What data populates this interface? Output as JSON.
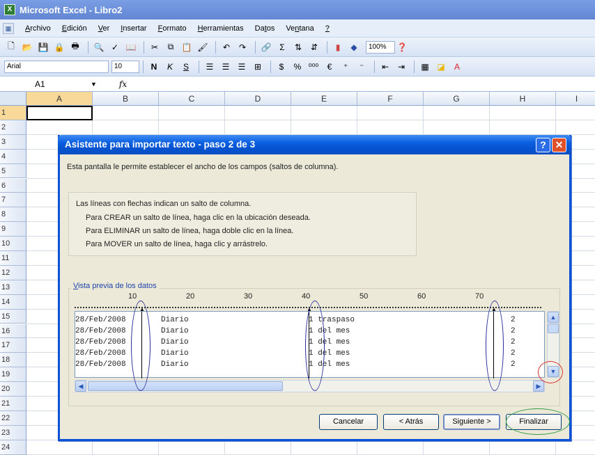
{
  "window": {
    "title": "Microsoft Excel - Libro2"
  },
  "menu": {
    "items": [
      {
        "pre": "",
        "u": "A",
        "post": "rchivo"
      },
      {
        "pre": "",
        "u": "E",
        "post": "dición"
      },
      {
        "pre": "",
        "u": "V",
        "post": "er"
      },
      {
        "pre": "",
        "u": "I",
        "post": "nsertar"
      },
      {
        "pre": "",
        "u": "F",
        "post": "ormato"
      },
      {
        "pre": "",
        "u": "H",
        "post": "erramientas"
      },
      {
        "pre": "Da",
        "u": "t",
        "post": "os"
      },
      {
        "pre": "Ve",
        "u": "n",
        "post": "tana"
      },
      {
        "pre": "",
        "u": "?",
        "post": ""
      }
    ]
  },
  "toolbar": {
    "zoom": "100%",
    "font": "Arial",
    "size": "10",
    "bold": "N",
    "italic": "K",
    "underline": "S"
  },
  "formula": {
    "namebox": "A1",
    "fx": "fx"
  },
  "sheet": {
    "columns": [
      "A",
      "B",
      "C",
      "D",
      "E",
      "F",
      "G",
      "H",
      "I"
    ],
    "rows": [
      "1",
      "2",
      "3",
      "4",
      "5",
      "6",
      "7",
      "8",
      "9",
      "10",
      "11",
      "12",
      "13",
      "14",
      "15",
      "16",
      "17",
      "18",
      "19",
      "20",
      "21",
      "22",
      "23",
      "24"
    ]
  },
  "dialog": {
    "title": "Asistente para importar texto - paso 2 de 3",
    "help_glyph": "?",
    "close_glyph": "✕",
    "intro": "Esta pantalla le permite establecer el ancho de los campos (saltos de columna).",
    "instructions": {
      "head": "Las líneas con flechas indican un salto de columna.",
      "lines": [
        "Para CREAR un salto de línea, haga clic en la ubicación deseada.",
        "Para ELIMINAR un salto de línea, haga doble clic en la línea.",
        "Para MOVER un salto de línea, haga clic y arrástrelo."
      ]
    },
    "preview": {
      "label": "Vista previa de los datos",
      "ruler": [
        "10",
        "20",
        "30",
        "40",
        "50",
        "60",
        "70"
      ],
      "rows": [
        {
          "date": "28/Feb/2008",
          "type": "Diario",
          "concept": "1 traspaso",
          "num": "2"
        },
        {
          "date": "28/Feb/2008",
          "type": "Diario",
          "concept": "1 del mes",
          "num": "2"
        },
        {
          "date": "28/Feb/2008",
          "type": "Diario",
          "concept": "1 del mes",
          "num": "2"
        },
        {
          "date": "28/Feb/2008",
          "type": "Diario",
          "concept": "1 del mes",
          "num": "2"
        },
        {
          "date": "28/Feb/2008",
          "type": "Diario",
          "concept": "1 del mes",
          "num": "2"
        }
      ]
    },
    "buttons": {
      "cancel": "Cancelar",
      "back": "< Atrás",
      "next": "Siguiente >",
      "finish": "Finalizar"
    }
  }
}
